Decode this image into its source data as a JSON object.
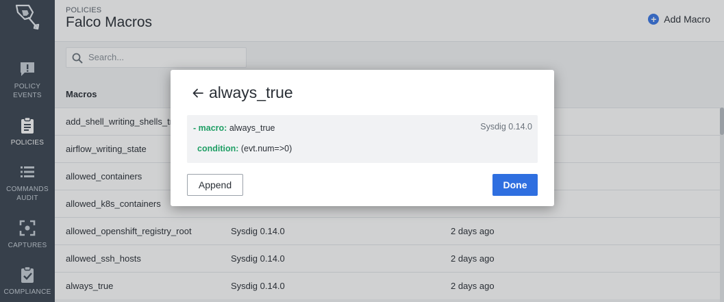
{
  "sidebar": {
    "items": [
      {
        "label_line1": "POLICY",
        "label_line2": "EVENTS",
        "icon": "alert-bubble-icon"
      },
      {
        "label_line1": "POLICIES",
        "label_line2": "",
        "icon": "clipboard-icon"
      },
      {
        "label_line1": "COMMANDS",
        "label_line2": "AUDIT",
        "icon": "list-icon"
      },
      {
        "label_line1": "CAPTURES",
        "label_line2": "",
        "icon": "capture-frame-icon"
      },
      {
        "label_line1": "COMPLIANCE",
        "label_line2": "",
        "icon": "clipboard-check-icon"
      }
    ]
  },
  "header": {
    "breadcrumb": "POLICIES",
    "title": "Falco Macros",
    "add_label": "Add Macro",
    "add_symbol": "+"
  },
  "search": {
    "placeholder": "Search..."
  },
  "table": {
    "col_macros": "Macros",
    "rows": [
      {
        "name": "add_shell_writing_shells_tm",
        "source": "",
        "updated": ""
      },
      {
        "name": "airflow_writing_state",
        "source": "",
        "updated": ""
      },
      {
        "name": "allowed_containers",
        "source": "",
        "updated": ""
      },
      {
        "name": "allowed_k8s_containers",
        "source": "",
        "updated": ""
      },
      {
        "name": "allowed_openshift_registry_root",
        "source": "Sysdig 0.14.0",
        "updated": "2 days ago"
      },
      {
        "name": "allowed_ssh_hosts",
        "source": "Sysdig 0.14.0",
        "updated": "2 days ago"
      },
      {
        "name": "always_true",
        "source": "Sysdig 0.14.0",
        "updated": "2 days ago"
      }
    ]
  },
  "modal": {
    "title": "always_true",
    "dash": "- ",
    "macro_key": "macro:",
    "macro_value": "always_true",
    "condition_key": "condition:",
    "condition_value": "(evt.num=>0)",
    "version": "Sysdig 0.14.0",
    "append_label": "Append",
    "done_label": "Done"
  },
  "colors": {
    "sidebar_bg": "#3b4653",
    "accent_blue": "#2f6fe0",
    "yaml_key_green": "#1e9e64"
  }
}
